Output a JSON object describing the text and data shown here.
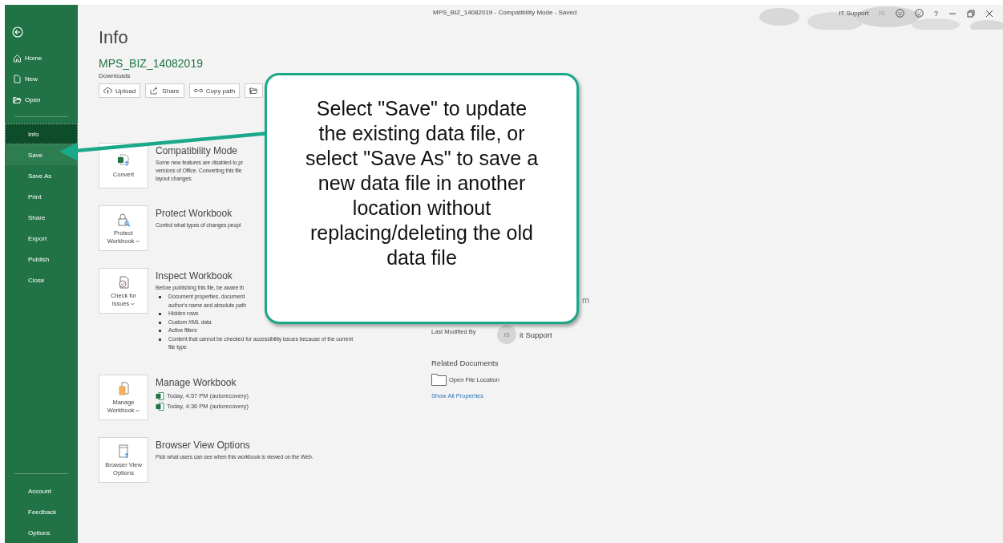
{
  "window": {
    "title": "MPS_BIZ_14082019  -  Compatibility Mode  -  Saved",
    "user": "IT Support",
    "user_initials": "IS",
    "help": "?"
  },
  "sidebar": {
    "top": [
      {
        "label": "Home",
        "kind": "file",
        "selected": false
      },
      {
        "label": "New",
        "kind": "file",
        "selected": false
      },
      {
        "label": "Open",
        "kind": "file",
        "selected": false
      }
    ],
    "middle": [
      {
        "label": "Info",
        "kind": "section",
        "selected": true
      },
      {
        "label": "Save",
        "kind": "section",
        "selected": false,
        "hovered": true
      },
      {
        "label": "Save As",
        "kind": "section",
        "selected": false
      },
      {
        "label": "Print",
        "kind": "section",
        "selected": false
      },
      {
        "label": "Share",
        "kind": "section",
        "selected": false
      },
      {
        "label": "Export",
        "kind": "section",
        "selected": false
      },
      {
        "label": "Publish",
        "kind": "section",
        "selected": false
      },
      {
        "label": "Close",
        "kind": "section",
        "selected": false
      }
    ],
    "bottom": [
      {
        "label": "Account",
        "kind": "section",
        "selected": false
      },
      {
        "label": "Feedback",
        "kind": "section",
        "selected": false
      },
      {
        "label": "Options",
        "kind": "section",
        "selected": false
      }
    ]
  },
  "page": {
    "title": "Info",
    "file_name": "MPS_BIZ_14082019",
    "location": "Downloads",
    "buttons": [
      {
        "kind": "upload",
        "label": "Upload"
      },
      {
        "kind": "share",
        "label": "Share"
      },
      {
        "kind": "copy",
        "label": "Copy path"
      },
      {
        "kind": "folder"
      }
    ],
    "sections": [
      {
        "kind": "convert",
        "card": [
          "Convert"
        ],
        "dropdown": false,
        "title": "Compatibility Mode",
        "description": [
          "Some new features are disabled to pr",
          "versions of Office. Converting this file",
          "layout changes."
        ]
      },
      {
        "kind": "protect",
        "card": [
          "Protect",
          "Workbook"
        ],
        "dropdown": true,
        "title": "Protect Workbook",
        "description": [
          "Control what types of changes peopl"
        ]
      },
      {
        "kind": "inspect",
        "card": [
          "Check for",
          "Issues"
        ],
        "dropdown": true,
        "title": "Inspect Workbook",
        "description": [
          "Before publishing this file, be aware th"
        ],
        "bullets": [
          [
            "Document properties, document",
            "author's name and absolute path"
          ],
          [
            "Hidden rows"
          ],
          [
            "Custom XML data"
          ],
          [
            "Active filters"
          ],
          [
            "Content that cannot be checked for accessibility issues because of the current",
            "file type"
          ]
        ]
      },
      {
        "kind": "manage",
        "card": [
          "Manage",
          "Workbook"
        ],
        "dropdown": true,
        "title": "Manage Workbook",
        "files": [
          "Today, 4:57 PM (autorecovery)",
          "Today, 4:36 PM (autorecovery)"
        ]
      },
      {
        "kind": "browser",
        "card": [
          "Browser View",
          "Options"
        ],
        "dropdown": false,
        "title": "Browser View Options",
        "description": [
          "Pick what users can see when this workbook is viewed on the Web."
        ]
      }
    ]
  },
  "properties": {
    "fragment": "m",
    "last_modified_label": "Last Modified By",
    "modifier_initials": "IS",
    "modifier_name": "it Support",
    "related_heading": "Related Documents",
    "open_location": "Open File Location",
    "show_all": "Show All Properties"
  },
  "callout": {
    "lines": [
      "Select \"Save\" to update",
      "the existing data file, or",
      "select \"Save As\" to save a",
      "new data file in another",
      "location without",
      "replacing/deleting the old",
      "data file"
    ]
  }
}
